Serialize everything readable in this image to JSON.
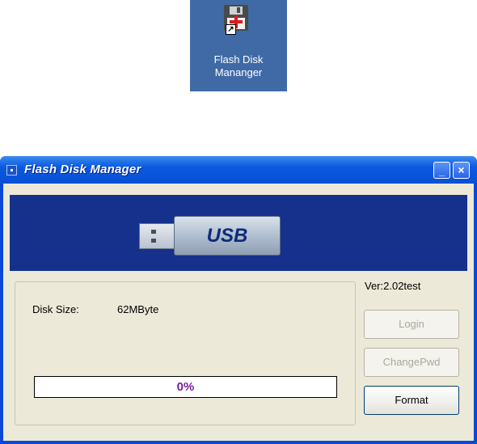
{
  "desktop": {
    "shortcut_caption_line1": "Flash Disk",
    "shortcut_caption_line2": "Mananger",
    "shortcut_icon": "floppy-disk-with-red-plus-icon"
  },
  "window": {
    "title": "Flash Disk Manager",
    "minimize_label": "_",
    "close_label": "×",
    "banner_text": "USB",
    "version": "Ver:2.02test",
    "disk_size_label": "Disk Size:",
    "disk_size_value": "62MByte",
    "progress_text": "0%",
    "progress_fraction": 0,
    "buttons": {
      "login": "Login",
      "change_pwd": "ChangePwd",
      "format": "Format"
    }
  },
  "colors": {
    "titlebar": "#0a5ae0",
    "banner": "#15318c",
    "progress_text": "#7a1ea0"
  }
}
